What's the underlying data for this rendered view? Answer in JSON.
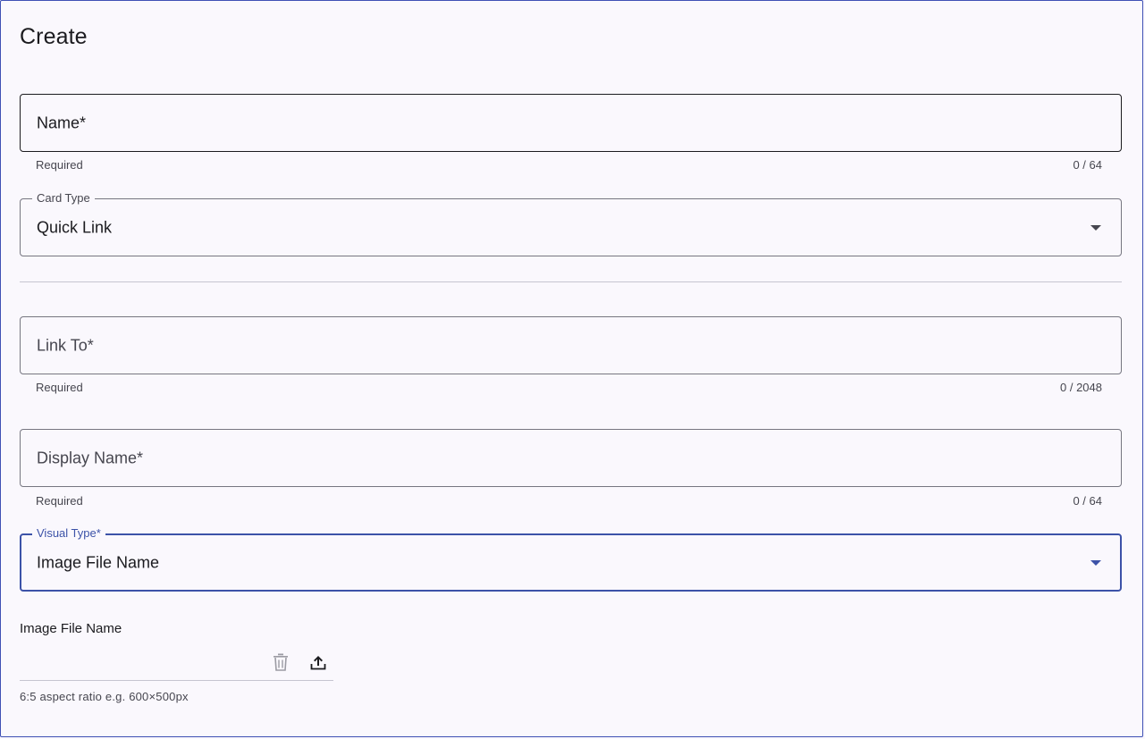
{
  "page": {
    "title": "Create"
  },
  "form": {
    "name": {
      "label": "Name*",
      "hint": "Required",
      "counter": "0 / 64"
    },
    "card_type": {
      "label": "Card Type",
      "value": "Quick Link"
    },
    "link_to": {
      "label": "Link To*",
      "hint": "Required",
      "counter": "0 / 2048"
    },
    "display_name": {
      "label": "Display Name*",
      "hint": "Required",
      "counter": "0 / 64"
    },
    "visual_type": {
      "label": "Visual Type*",
      "value": "Image File Name"
    },
    "image_upload": {
      "label": "Image File Name",
      "note": "6:5 aspect ratio e.g. 600×500px",
      "delete_icon": "trash-icon",
      "upload_icon": "upload-icon"
    }
  },
  "colors": {
    "accent": "#3c52a8",
    "background": "#faf8fd",
    "outline": "#767680",
    "text": "#1b1b1f",
    "muted": "#46464f"
  }
}
